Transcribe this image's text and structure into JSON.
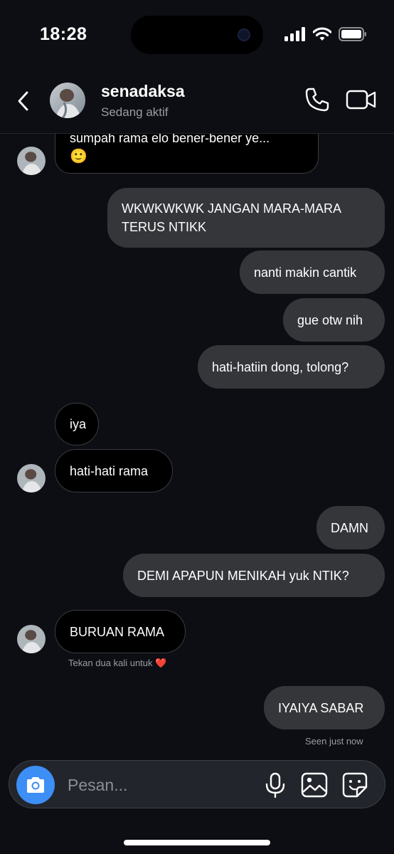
{
  "status_bar": {
    "time": "18:28"
  },
  "header": {
    "contact_name": "senadaksa",
    "contact_status": "Sedang aktif"
  },
  "messages": [
    {
      "side": "in",
      "text": "sumpah rama elo bener-bener ye...",
      "emoji": "🙂"
    },
    {
      "side": "out",
      "text": "WKWKWKWK JANGAN MARA-MARA TERUS NTIKK"
    },
    {
      "side": "out",
      "text": "nanti makin cantik"
    },
    {
      "side": "out",
      "text": "gue otw nih"
    },
    {
      "side": "out",
      "text": "hati-hatiin dong, tolong?"
    },
    {
      "side": "in",
      "text": "iya"
    },
    {
      "side": "in",
      "text": "hati-hati rama"
    },
    {
      "side": "out",
      "text": "DAMN"
    },
    {
      "side": "out",
      "text": "DEMI APAPUN MENIKAH yuk NTIK?"
    },
    {
      "side": "in",
      "text": "BURUAN RAMA"
    },
    {
      "side": "out",
      "text": "IYAIYA SABAR"
    }
  ],
  "double_tap_hint": "Tekan dua kali untuk ❤️",
  "seen_status": "Seen just now",
  "composer": {
    "placeholder": "Pesan..."
  },
  "icons": {
    "back": "chevron-left-icon",
    "call": "phone-icon",
    "video": "video-camera-icon",
    "camera": "camera-icon",
    "mic": "microphone-icon",
    "gallery": "image-icon",
    "sticker": "sticker-icon"
  },
  "colors": {
    "background": "#0c0e13",
    "incoming_bubble": "#000000",
    "outgoing_bubble": "#35363a",
    "camera_button": "#3d8ef5",
    "secondary_text": "#9a9da4"
  }
}
